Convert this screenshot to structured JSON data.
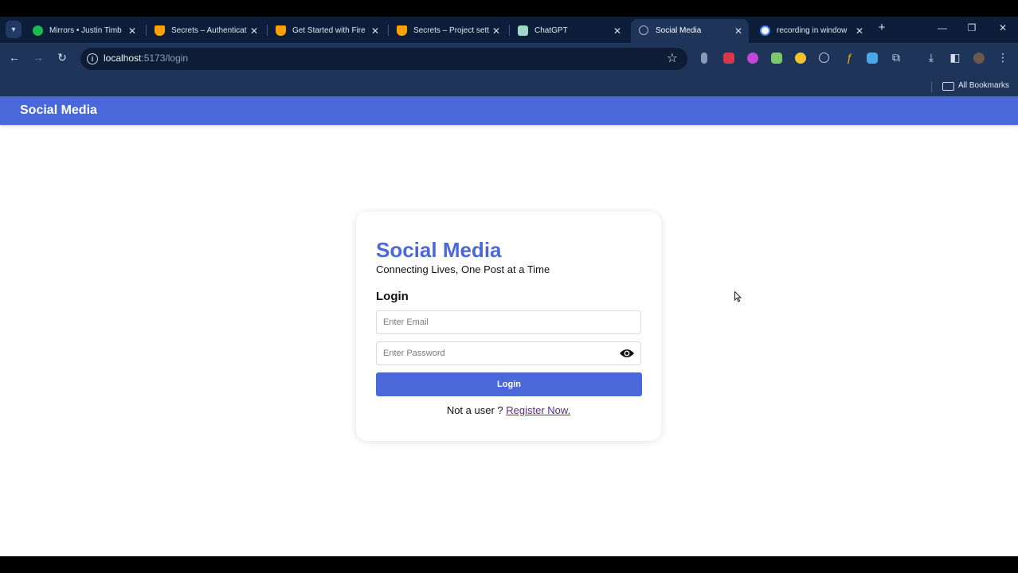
{
  "browser": {
    "tabs": [
      {
        "title": "Mirrors • Justin Timb",
        "favicon": "spotify-icon",
        "color": "#1db954",
        "active": false
      },
      {
        "title": "Secrets – Authenticat",
        "favicon": "firebase-icon",
        "color": "#ffa000",
        "active": false
      },
      {
        "title": "Get Started with Fire",
        "favicon": "firebase-icon",
        "color": "#ffa000",
        "active": false
      },
      {
        "title": "Secrets – Project sett",
        "favicon": "firebase-icon",
        "color": "#ffa000",
        "active": false
      },
      {
        "title": "ChatGPT",
        "favicon": "chatgpt-icon",
        "color": "#9fd8c8",
        "active": false
      },
      {
        "title": "Social Media",
        "favicon": "globe-icon",
        "color": "#aab4c6",
        "active": true
      },
      {
        "title": "recording in window",
        "favicon": "google-icon",
        "color": "#ffffff",
        "active": false
      }
    ],
    "address_bar": {
      "host": "localhost",
      "path": ":5173/login"
    },
    "bookmarks_label": "All Bookmarks"
  },
  "app": {
    "navbar_title": "Social Media",
    "brand_color": "#4a68d9"
  },
  "login_card": {
    "brand": "Social Media",
    "tagline": "Connecting Lives, One Post at a Time",
    "heading": "Login",
    "email_placeholder": "Enter Email",
    "password_placeholder": "Enter Password",
    "login_button": "Login",
    "register_prompt": "Not a user ?",
    "register_link": "Register Now."
  }
}
